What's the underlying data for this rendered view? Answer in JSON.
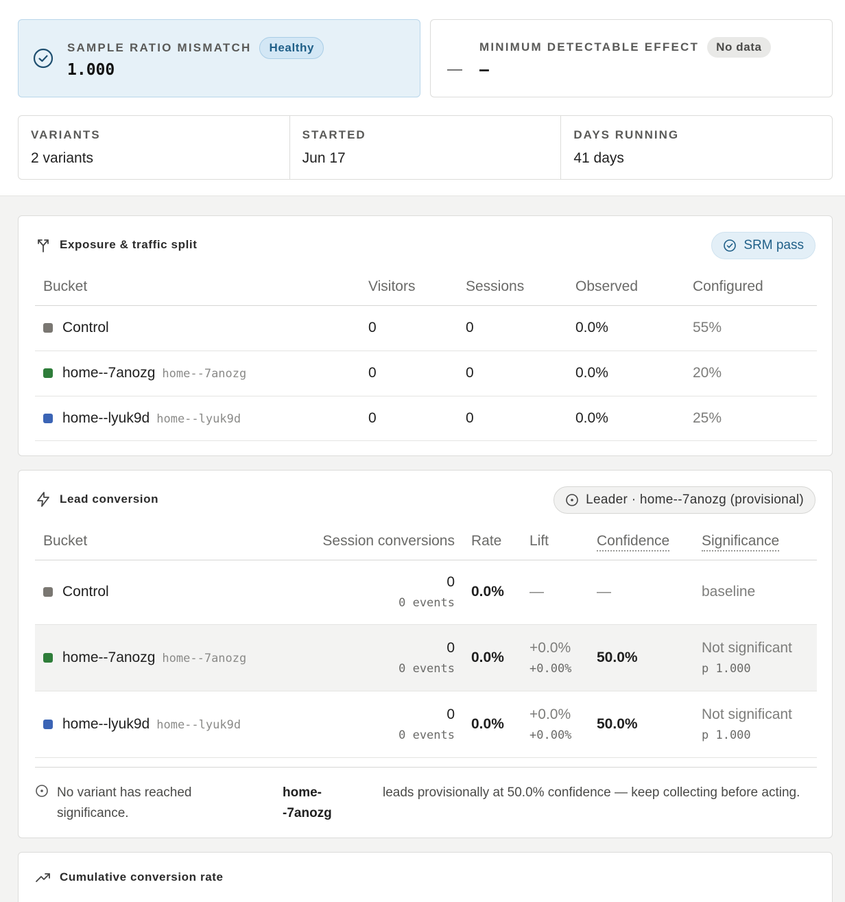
{
  "srm_card": {
    "label": "SAMPLE RATIO MISMATCH",
    "status": "Healthy",
    "value": "1.000"
  },
  "mde_card": {
    "label": "MINIMUM DETECTABLE EFFECT",
    "status": "No data",
    "value": "–"
  },
  "meta": [
    {
      "label": "VARIANTS",
      "value": "2 variants"
    },
    {
      "label": "STARTED",
      "value": "Jun 17"
    },
    {
      "label": "DAYS RUNNING",
      "value": "41 days"
    }
  ],
  "exposure": {
    "title": "Exposure & traffic split",
    "badge": "SRM pass",
    "headers": [
      "Bucket",
      "Visitors",
      "Sessions",
      "Observed",
      "Configured"
    ],
    "rows": [
      {
        "name": "Control",
        "slug": "",
        "color": "#7a7772",
        "visitors": "0",
        "sessions": "0",
        "observed": "0.0%",
        "configured": "55%"
      },
      {
        "name": "home--7anozg",
        "slug": "home--7anozg",
        "color": "#2e7d3a",
        "visitors": "0",
        "sessions": "0",
        "observed": "0.0%",
        "configured": "20%"
      },
      {
        "name": "home--lyuk9d",
        "slug": "home--lyuk9d",
        "color": "#3b64b5",
        "visitors": "0",
        "sessions": "0",
        "observed": "0.0%",
        "configured": "25%"
      }
    ]
  },
  "conversion": {
    "title": "Lead conversion",
    "badge": "Leader · home--7anozg (provisional)",
    "headers": [
      "Bucket",
      "Session conversions",
      "Rate",
      "Lift",
      "Confidence",
      "Significance"
    ],
    "rows": [
      {
        "name": "Control",
        "slug": "",
        "color": "#7a7772",
        "conv": "0",
        "events": "0 events",
        "rate": "0.0%",
        "lift": "—",
        "lift_sub": "",
        "confidence": "—",
        "significance": "baseline",
        "p": ""
      },
      {
        "name": "home--7anozg",
        "slug": "home--7anozg",
        "color": "#2e7d3a",
        "conv": "0",
        "events": "0 events",
        "rate": "0.0%",
        "lift": "+0.0%",
        "lift_sub": "+0.00%",
        "confidence": "50.0%",
        "significance": "Not significant",
        "p": "p 1.000"
      },
      {
        "name": "home--lyuk9d",
        "slug": "home--lyuk9d",
        "color": "#3b64b5",
        "conv": "0",
        "events": "0 events",
        "rate": "0.0%",
        "lift": "+0.0%",
        "lift_sub": "+0.00%",
        "confidence": "50.0%",
        "significance": "Not significant",
        "p": "p 1.000"
      }
    ],
    "note_a": "No variant has reached significance.",
    "note_b": "home--7anozg",
    "note_c": "leads provisionally at 50.0% confidence — keep collecting before acting."
  },
  "cumulative": {
    "title": "Cumulative conversion rate"
  }
}
